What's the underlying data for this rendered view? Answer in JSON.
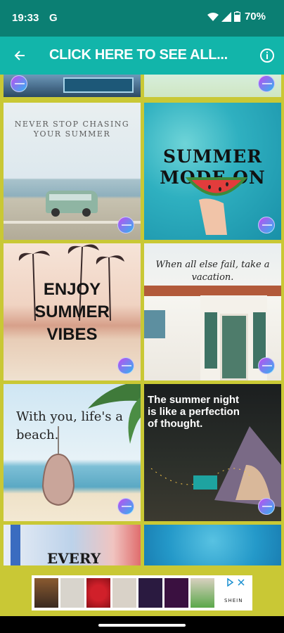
{
  "status_bar": {
    "time": "19:33",
    "carrier_letter": "G",
    "battery": "70%",
    "icons": [
      "wifi-icon",
      "signal-icon",
      "battery-icon"
    ]
  },
  "app_bar": {
    "title": "CLICK HERE TO SEE ALL...",
    "back_icon": "arrow-back-icon",
    "info_icon": "info-icon",
    "color": "#12b5aa"
  },
  "grid": {
    "background": "#c9c835",
    "tiles": [
      {
        "id": "partial-top-left",
        "text": ""
      },
      {
        "id": "partial-top-right",
        "text": ""
      },
      {
        "id": "never-stop",
        "text": "NEVER STOP CHASING YOUR SUMMER"
      },
      {
        "id": "summer-mode",
        "text": "SUMMER MODE ON"
      },
      {
        "id": "enjoy-summer",
        "text": "ENJOY SUMMER VIBES"
      },
      {
        "id": "vacation",
        "text": "When all else fail, take a vacation."
      },
      {
        "id": "beach",
        "text": "With you, life's a beach."
      },
      {
        "id": "summer-night",
        "text": "The summer night is like a perfection of thought."
      },
      {
        "id": "every",
        "text": "EVERY"
      },
      {
        "id": "partial-bottom-right",
        "text": ""
      }
    ]
  },
  "ad": {
    "brand": "SHEIN"
  }
}
